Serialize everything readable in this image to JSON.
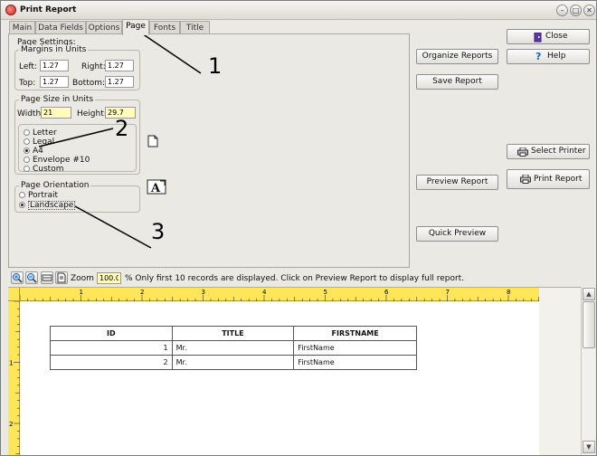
{
  "window": {
    "title": "Print Report",
    "minimize": "–",
    "maximize": "□",
    "close": "✕"
  },
  "tabs": [
    "Main",
    "Data Fields",
    "Options",
    "Page",
    "Fonts",
    "Title"
  ],
  "page_settings": {
    "legend": "Page Settings:",
    "margins": {
      "legend": "Margins in Units",
      "left_label": "Left:",
      "left": "1.27",
      "right_label": "Right:",
      "right": "1.27",
      "top_label": "Top:",
      "top": "1.27",
      "bottom_label": "Bottom:",
      "bottom": "1.27"
    },
    "size": {
      "legend": "Page Size in Units",
      "width_label": "Width:",
      "width": "21",
      "height_label": "Height:",
      "height": "29.7",
      "options": [
        "Letter",
        "Legal",
        "A4",
        "Envelope #10",
        "Custom"
      ],
      "selected": "A4"
    },
    "orientation": {
      "legend": "Page Orientation",
      "options": [
        "Portrait",
        "Landscape"
      ],
      "selected": "Landscape"
    }
  },
  "buttons": {
    "organize": "Organize Reports",
    "save": "Save Report",
    "preview": "Preview Report",
    "quick": "Quick Preview",
    "close": "Close",
    "help": "Help",
    "select_printer": "Select Printer",
    "print": "Print Report"
  },
  "toolbar": {
    "zoom_label": "Zoom",
    "zoom_value": "100.0",
    "message": "% Only first 10 records are displayed. Click on Preview Report to display full report."
  },
  "ruler": {
    "top_numbers": [
      "1",
      "2",
      "3",
      "4",
      "5",
      "6",
      "7",
      "8"
    ],
    "left_numbers": [
      "1",
      "2"
    ]
  },
  "report_table": {
    "columns": [
      "ID",
      "TITLE",
      "FIRSTNAME"
    ],
    "rows": [
      {
        "id": "1",
        "title": "Mr.",
        "firstname": "FirstName"
      },
      {
        "id": "2",
        "title": "Mr.",
        "firstname": "FirstName"
      }
    ]
  },
  "annotations": [
    "1",
    "2",
    "3"
  ],
  "icons": {
    "app": "print-report-icon",
    "page_size_preview": "portrait-page-icon",
    "orientation_preview": "landscape-a-icon",
    "close": "door-exit-icon",
    "help": "question-mark-icon",
    "printer": "printer-icon",
    "zoom_in": "zoom-in-icon",
    "zoom_out": "zoom-out-icon"
  }
}
